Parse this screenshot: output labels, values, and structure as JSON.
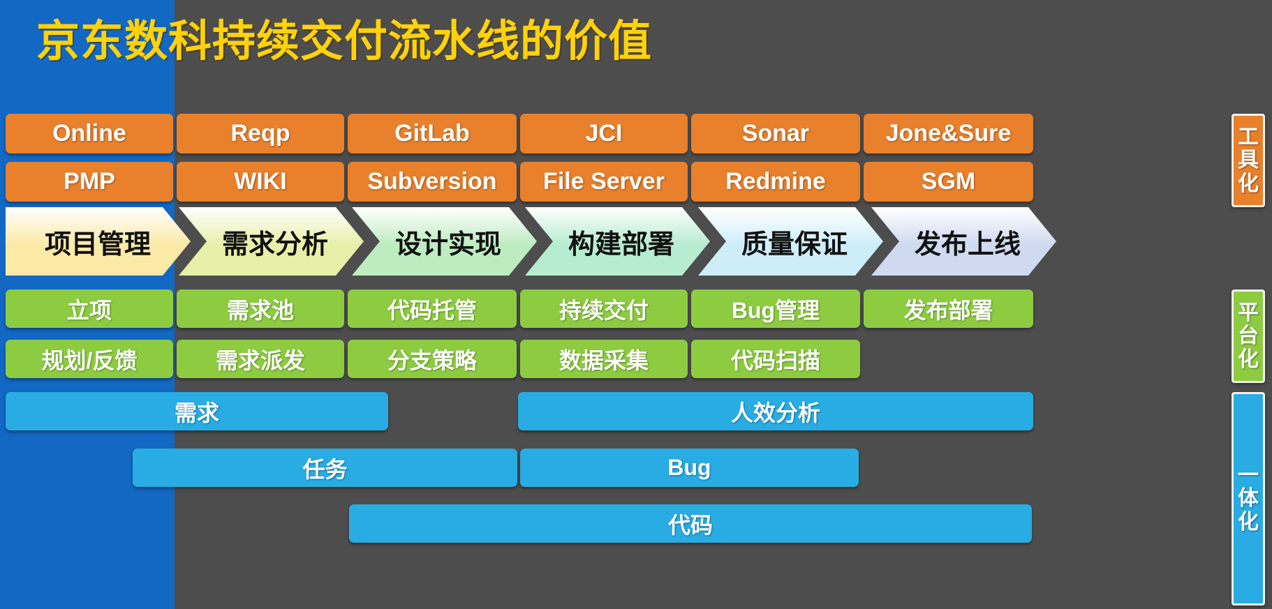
{
  "page": {
    "title": "京东数科持续交付流水线的价值",
    "background_color": "#4d4d4d",
    "left_band_color": "#1268c3",
    "title_color": "#ffd20a"
  },
  "tools_row_1": [
    {
      "label": "Online"
    },
    {
      "label": "Reqp"
    },
    {
      "label": "GitLab"
    },
    {
      "label": "JCI"
    },
    {
      "label": "Sonar"
    },
    {
      "label": "Jone&Sure"
    }
  ],
  "tools_row_2": [
    {
      "label": "PMP"
    },
    {
      "label": "WIKI"
    },
    {
      "label": "Subversion"
    },
    {
      "label": "File Server"
    },
    {
      "label": "Redmine"
    },
    {
      "label": "SGM"
    }
  ],
  "stages": [
    {
      "label": "项目管理",
      "color": "#fbe9a6"
    },
    {
      "label": "需求分析",
      "color": "#e6f0a8"
    },
    {
      "label": "设计实现",
      "color": "#bdecc0"
    },
    {
      "label": "构建部署",
      "color": "#b6eccf"
    },
    {
      "label": "质量保证",
      "color": "#cdeef9"
    },
    {
      "label": "发布上线",
      "color": "#cfd9ef"
    }
  ],
  "platform_row_1": [
    {
      "label": "立项"
    },
    {
      "label": "需求池"
    },
    {
      "label": "代码托管"
    },
    {
      "label": "持续交付"
    },
    {
      "label": "Bug管理"
    },
    {
      "label": "发布部署"
    }
  ],
  "platform_row_2": [
    {
      "label": "规划/反馈"
    },
    {
      "label": "需求派发"
    },
    {
      "label": "分支策略"
    },
    {
      "label": "数据采集"
    },
    {
      "label": "代码扫描"
    }
  ],
  "integration_row_1": [
    {
      "label": "需求"
    },
    {
      "label": "人效分析"
    }
  ],
  "integration_row_2": [
    {
      "label": "任务"
    },
    {
      "label": "Bug"
    }
  ],
  "integration_row_3": [
    {
      "label": "代码"
    }
  ],
  "side_labels": [
    {
      "label": "工具化",
      "color": "#e8802c"
    },
    {
      "label": "平台化",
      "color": "#8dcc41"
    },
    {
      "label": "一体化",
      "color": "#28ace3"
    }
  ]
}
